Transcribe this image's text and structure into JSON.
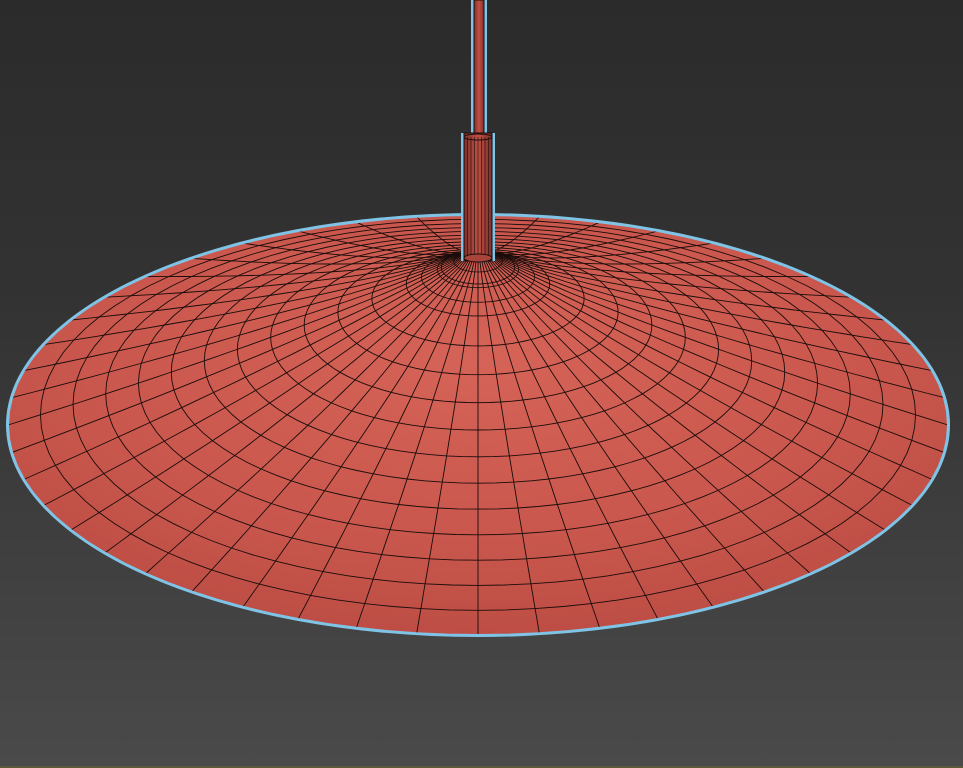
{
  "viewport": {
    "mode": "3d-perspective-viewport",
    "background_top": "#2b2b2b",
    "background_bottom": "#4a4a4a"
  },
  "model": {
    "object": "pendant-lamp-shade",
    "shade_color": "#c9574d",
    "shade_shadow_color": "#b84a41",
    "wire_color": "#1a0c0a",
    "selection_outline_color": "#7fc4e6",
    "stem_color": "#a8443b",
    "radial_segments": 48,
    "ring_count": 14
  }
}
